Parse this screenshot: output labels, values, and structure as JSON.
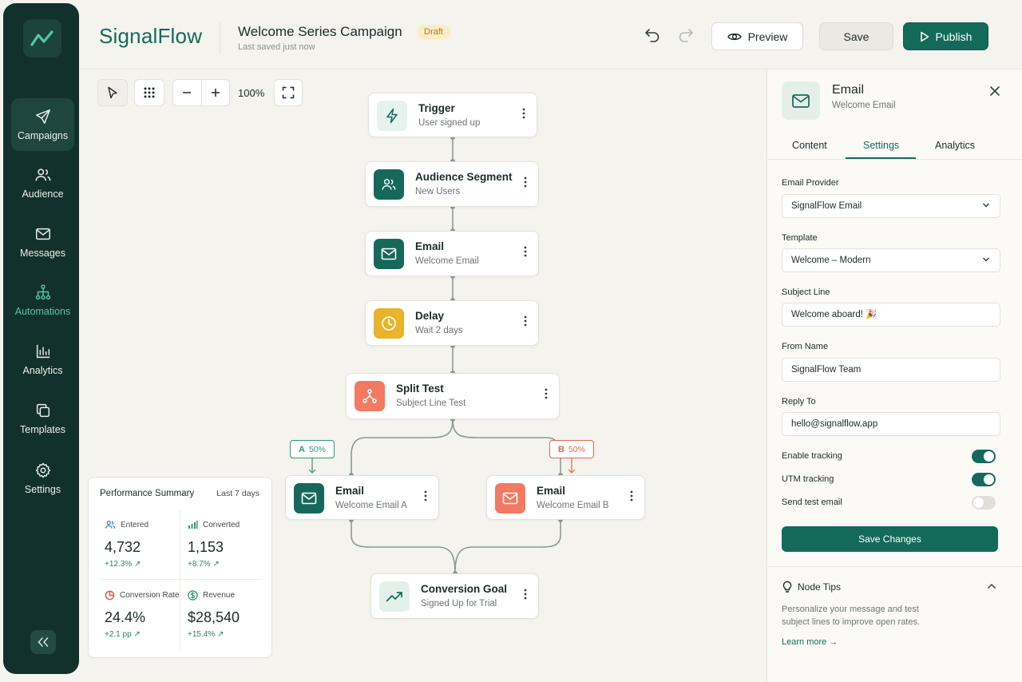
{
  "brand": "SignalFlow",
  "header": {
    "campaign_title": "Welcome Series Campaign",
    "status": "Draft",
    "saved": "Last saved just now",
    "preview_label": "Preview",
    "save_label": "Save",
    "publish_label": "Publish"
  },
  "sidebar": {
    "items": [
      {
        "label": "Campaigns",
        "icon": "send-icon"
      },
      {
        "label": "Audience",
        "icon": "users-icon"
      },
      {
        "label": "Messages",
        "icon": "mail-icon"
      },
      {
        "label": "Automations",
        "icon": "flow-icon"
      },
      {
        "label": "Analytics",
        "icon": "bar-chart-icon"
      },
      {
        "label": "Templates",
        "icon": "copy-icon"
      },
      {
        "label": "Settings",
        "icon": "gear-icon"
      }
    ]
  },
  "toolbar": {
    "zoom": "100%"
  },
  "nodes": {
    "trigger": {
      "title": "Trigger",
      "sub": "User signed up"
    },
    "audience": {
      "title": "Audience Segment",
      "sub": "New Users"
    },
    "email": {
      "title": "Email",
      "sub": "Welcome Email"
    },
    "delay": {
      "title": "Delay",
      "sub": "Wait 2 days"
    },
    "split": {
      "title": "Split Test",
      "sub": "Subject Line Test"
    },
    "email_a": {
      "title": "Email",
      "sub": "Welcome Email A"
    },
    "email_b": {
      "title": "Email",
      "sub": "Welcome Email B"
    },
    "goal": {
      "title": "Conversion Goal",
      "sub": "Signed Up for Trial"
    }
  },
  "split": {
    "a": {
      "letter": "A",
      "pct": "50%"
    },
    "b": {
      "letter": "B",
      "pct": "50%"
    }
  },
  "performance": {
    "title": "Performance Summary",
    "range": "Last 7 days",
    "metrics": [
      {
        "label": "Entered",
        "value": "4,732",
        "delta": "+12.3% ↗"
      },
      {
        "label": "Converted",
        "value": "1,153",
        "delta": "+8.7% ↗"
      },
      {
        "label": "Conversion Rate",
        "value": "24.4%",
        "delta": "+2.1 pp ↗"
      },
      {
        "label": "Revenue",
        "value": "$28,540",
        "delta": "+15.4% ↗"
      }
    ]
  },
  "panel": {
    "title": "Email",
    "sub": "Welcome Email",
    "tabs": [
      "Content",
      "Settings",
      "Analytics"
    ],
    "fields": {
      "provider_label": "Email Provider",
      "provider_value": "SignalFlow Email",
      "template_label": "Template",
      "template_value": "Welcome – Modern",
      "subject_label": "Subject Line",
      "subject_value": "Welcome aboard! 🎉",
      "from_label": "From Name",
      "from_value": "SignalFlow Team",
      "reply_label": "Reply To",
      "reply_value": "hello@signalflow.app"
    },
    "toggles": [
      {
        "label": "Enable tracking",
        "on": true
      },
      {
        "label": "UTM tracking",
        "on": true
      },
      {
        "label": "Send test email",
        "on": false
      }
    ],
    "save_changes": "Save Changes",
    "tips": {
      "title": "Node Tips",
      "body": "Personalize your message and test subject lines to improve open rates.",
      "link": "Learn more →"
    }
  },
  "colors": {
    "brand": "#16695a",
    "sidebar": "#13312c",
    "delay": "#e9b32a",
    "split": "#f07b62",
    "draft_bg": "#fbecc9"
  }
}
